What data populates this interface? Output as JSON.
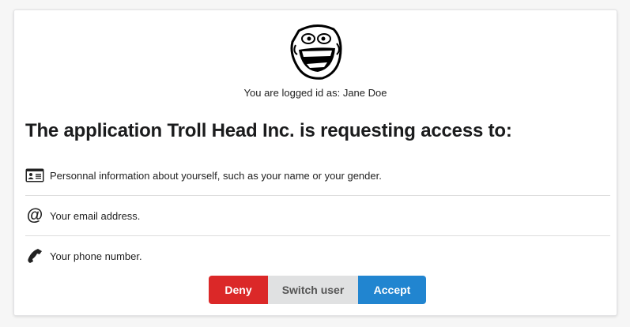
{
  "user": {
    "logged_as_text": "You are logged id as: Jane Doe"
  },
  "request": {
    "title": "The application Troll Head Inc. is requesting access to:"
  },
  "permissions": [
    {
      "icon": "id-card-icon",
      "label": "Personnal information about yourself, such as your name or your gender."
    },
    {
      "icon": "at-icon",
      "label": "Your email address."
    },
    {
      "icon": "phone-icon",
      "label": "Your phone number."
    }
  ],
  "actions": {
    "deny": "Deny",
    "switch_user": "Switch user",
    "accept": "Accept"
  },
  "colors": {
    "deny": "#db2828",
    "switch": "#e0e1e2",
    "accept": "#2185d0"
  }
}
